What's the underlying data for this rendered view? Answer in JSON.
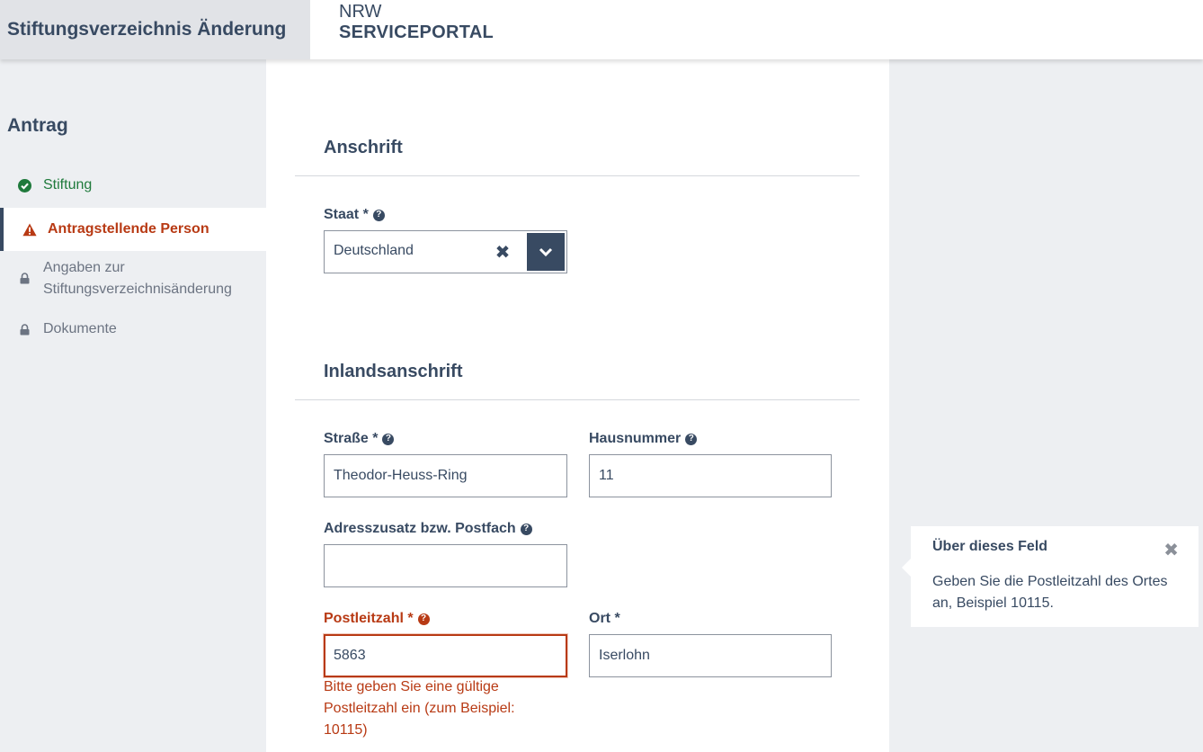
{
  "header": {
    "app_title": "Stiftungsverzeichnis Änderung",
    "brand_top": "NRW",
    "brand_bottom": "SERVICEPORTAL"
  },
  "sidebar": {
    "heading": "Antrag",
    "items": [
      {
        "label": "Stiftung",
        "state": "complete",
        "icon": "check-circle-icon"
      },
      {
        "label": "Antragstellende Person",
        "state": "active-error",
        "icon": "warning-triangle-icon"
      },
      {
        "label_line1": "Angaben zur",
        "label_line2": "Stiftungsverzeichnisänderung",
        "state": "locked",
        "icon": "lock-icon"
      },
      {
        "label": "Dokumente",
        "state": "locked",
        "icon": "lock-icon"
      }
    ]
  },
  "main": {
    "section_anschrift": "Anschrift",
    "staat": {
      "label": "Staat *",
      "value": "Deutschland"
    },
    "section_inland": "Inlandsanschrift",
    "strasse": {
      "label": "Straße *",
      "value": "Theodor-Heuss-Ring"
    },
    "hausnummer": {
      "label": "Hausnummer",
      "value": "11"
    },
    "adresszusatz": {
      "label": "Adresszusatz bzw. Postfach",
      "value": ""
    },
    "postleitzahl": {
      "label": "Postleitzahl *",
      "value": "5863",
      "error": "Bitte geben Sie eine gültige Postleitzahl ein (zum Beispiel: 10115)"
    },
    "ort": {
      "label": "Ort *",
      "value": "Iserlohn"
    }
  },
  "tooltip": {
    "title": "Über dieses Feld",
    "text": "Geben Sie die Postleitzahl des Ortes an, Beispiel 10115."
  },
  "colors": {
    "primary": "#384a62",
    "success": "#1f7a3c",
    "error": "#b83a14",
    "muted": "#6c7482",
    "background": "#edeff2"
  }
}
